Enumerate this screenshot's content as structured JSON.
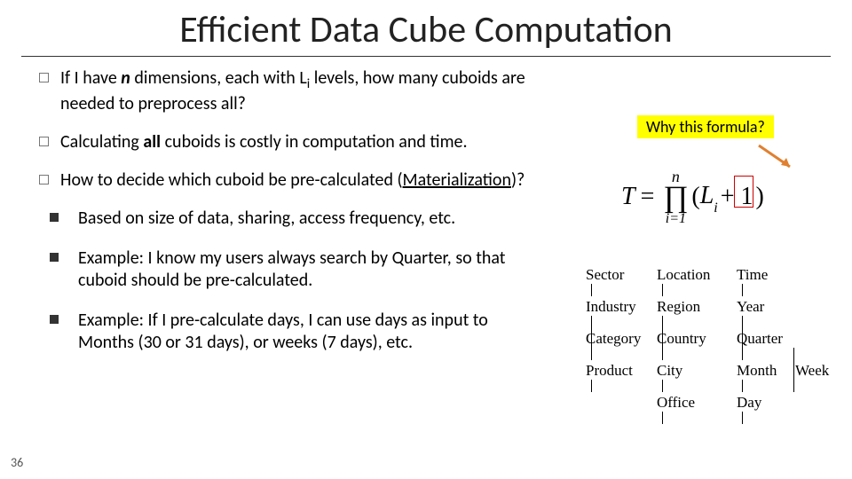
{
  "title": "Efficient Data Cube Computation",
  "pageNumber": "36",
  "callout": "Why this formula?",
  "bullets": {
    "b1_pre": "If I have ",
    "b1_n": "n",
    "b1_mid": " dimensions, each with L",
    "b1_sub": "i",
    "b1_post": " levels, how many cuboids are needed to preprocess all?",
    "b2_pre": "Calculating ",
    "b2_bold": "all",
    "b2_post": " cuboids is costly in computation and time.",
    "b3_pre": "How to decide which cuboid be pre-calculated (",
    "b3_link": "Materialization",
    "b3_post": ")?",
    "s1": "Based on size of data, sharing, access frequency, etc.",
    "s2": "Example: I know my users always search by Quarter, so that cuboid should be pre-calculated.",
    "s3": "Example: If I pre-calculate days, I can use days as input to Months (30 or 31 days), or weeks (7 days), etc."
  },
  "formula": {
    "T": "T",
    "eq": "=",
    "top": "n",
    "sym": "∏",
    "bot": "i=1",
    "open": "(",
    "L": "L",
    "Lsub": "i",
    "plus1": "+ 1",
    "close": ")"
  },
  "hier": {
    "c1": [
      "Sector",
      "Industry",
      "Category",
      "Product"
    ],
    "c2": [
      "Location",
      "Region",
      "Country",
      "City",
      "Office"
    ],
    "c3": [
      "Time",
      "Year",
      "Quarter",
      "Month",
      "Day"
    ],
    "c4": [
      "",
      "",
      "",
      "Week"
    ]
  }
}
